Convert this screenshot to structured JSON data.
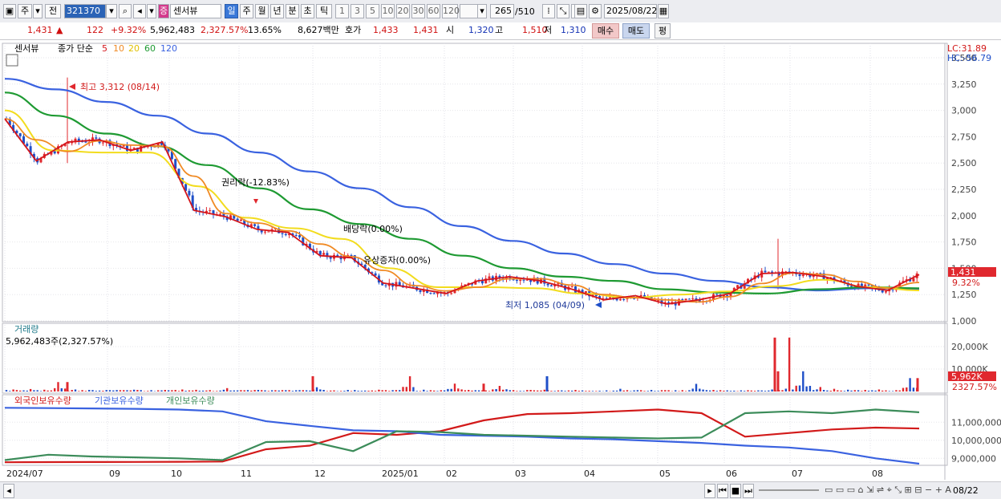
{
  "toolbar": {
    "code": "321370",
    "stock_name": "센서뷰",
    "date": "2025/08/22",
    "count": "265",
    "total": "/510",
    "left_labels": [
      "주",
      "전"
    ],
    "period_tabs": [
      "일",
      "주",
      "월",
      "년",
      "분",
      "초",
      "틱"
    ],
    "intervals": [
      "1",
      "3",
      "5",
      "10",
      "20",
      "30",
      "60",
      "120"
    ]
  },
  "quote": {
    "price": "1,431",
    "change": "122",
    "change_pct": "+9.32%",
    "volume": "5,962,483",
    "volume_ratio": "2,327.57%",
    "turnover_rate": "13.65%",
    "amount": "8,627백만",
    "ask_label": "호가",
    "ask": "1,433",
    "bid": "1,431",
    "open_label": "시",
    "open": "1,320",
    "high_label": "고",
    "high": "1,510",
    "low_label": "저",
    "low": "1,310",
    "buy_label": "매수",
    "sell_label": "매도",
    "avg_label": "평"
  },
  "legend": {
    "name": "센서뷰",
    "close_label": "종가 단순",
    "ma": [
      "5",
      "10",
      "20",
      "60",
      "120"
    ]
  },
  "colors": {
    "up": "#e0282e",
    "down": "#1f4fc8",
    "ma5": "#d4141a",
    "ma10": "#f08a24",
    "ma20": "#f2dc1e",
    "ma60": "#1e9a32",
    "ma120": "#3a62e0",
    "foreign": "#d21a1a",
    "institution": "#3a62e0",
    "individual": "#3c8c5a"
  },
  "chart_data": [
    {
      "type": "candlestick",
      "title": "센서뷰 일봉",
      "x": [
        "2024/07",
        "09",
        "10",
        "11",
        "12",
        "2025/01",
        "02",
        "03",
        "04",
        "05",
        "06",
        "07",
        "08"
      ],
      "ylim": [
        1000,
        3500
      ],
      "y_ticks": [
        "1,000",
        "1,250",
        "1,500",
        "1,750",
        "2,000",
        "2,250",
        "2,500",
        "2,750",
        "3,000",
        "3,250",
        "3,500"
      ],
      "lc": "LC:31.89",
      "hc": "HC:-56.79",
      "last_price": "1,431",
      "last_pct": "9.32%",
      "annotations": {
        "high": "최고 3,312 (08/14)",
        "low": "최저 1,085 (04/09)",
        "rights": "권리락(-12.83%)",
        "dividend": "배당락(0.00%)",
        "capital": "유상증자(0.00%)"
      },
      "ma120_points": [
        3300,
        3200,
        3080,
        2950,
        2780,
        2600,
        2420,
        2260,
        2080,
        1900,
        1760,
        1640,
        1540,
        1450,
        1380,
        1320,
        1290,
        1310,
        1305
      ],
      "ma60_points": [
        3170,
        2950,
        2780,
        2660,
        2480,
        2260,
        2060,
        1920,
        1780,
        1620,
        1500,
        1420,
        1380,
        1300,
        1270,
        1260,
        1300,
        1320,
        1310
      ],
      "ma20_points": [
        3000,
        2620,
        2600,
        2600,
        2280,
        1980,
        1880,
        1780,
        1500,
        1320,
        1320,
        1310,
        1260,
        1220,
        1250,
        1280,
        1330,
        1390,
        1320,
        1290
      ],
      "price_points": [
        2920,
        2520,
        2700,
        2720,
        2620,
        2700,
        2050,
        1990,
        1870,
        1840,
        1620,
        1600,
        1360,
        1310,
        1260,
        1380,
        1420,
        1380,
        1300,
        1200,
        1240,
        1160,
        1200,
        1260,
        1450,
        1460,
        1420,
        1330,
        1290,
        1440
      ]
    },
    {
      "type": "bar",
      "title": "거래량",
      "info": "5,962,483주(2,327.57%)",
      "ylim": [
        0,
        25000
      ],
      "y_ticks": [
        "10,000K",
        "20,000K"
      ],
      "last_value_label": "5,962K",
      "last_pct": "2327.57%",
      "values": [
        900,
        1100,
        800,
        4200,
        900,
        700,
        650,
        600,
        800,
        600,
        700,
        900,
        750,
        650,
        1500,
        600,
        700,
        550,
        900,
        600,
        1900,
        500,
        700,
        1000,
        800,
        600,
        6800,
        800,
        700,
        3500,
        700,
        500,
        2500,
        900,
        700,
        800,
        500,
        700,
        600,
        500,
        1200,
        600,
        700,
        500,
        600,
        3400,
        700,
        500,
        600,
        500,
        900,
        24000,
        9000,
        2000,
        1200,
        800,
        700,
        900,
        600,
        5962
      ]
    },
    {
      "type": "line",
      "title": "외국인보유수량",
      "series": [
        {
          "name": "외국인보유수량",
          "values": [
            8780000,
            8790000,
            8795000,
            8800000,
            8805000,
            8820000,
            9500000,
            9700000,
            10400000,
            10300000,
            10500000,
            11100000,
            11450000,
            11500000,
            11600000,
            11700000,
            11500000,
            10200000,
            10400000,
            10600000,
            10700000,
            10650000
          ]
        },
        {
          "name": "기관보유수량",
          "values": [
            11800000,
            11780000,
            11760000,
            11740000,
            11700000,
            11600000,
            11050000,
            10800000,
            10550000,
            10500000,
            10300000,
            10250000,
            10200000,
            10100000,
            10050000,
            9950000,
            9850000,
            9700000,
            9600000,
            9400000,
            9000000,
            8700000
          ]
        },
        {
          "name": "개인보유수량",
          "values": [
            8900000,
            9200000,
            9100000,
            9050000,
            9000000,
            8900000,
            9900000,
            9950000,
            9400000,
            10500000,
            10450000,
            10300000,
            10250000,
            10200000,
            10150000,
            10100000,
            10150000,
            11500000,
            11600000,
            11500000,
            11700000,
            11550000
          ]
        }
      ],
      "ylim": [
        8700000,
        11900000
      ],
      "y_ticks": [
        "9,000,000",
        "10,000,000",
        "11,000,000"
      ]
    }
  ],
  "bottom": {
    "end_date": "08/22"
  }
}
